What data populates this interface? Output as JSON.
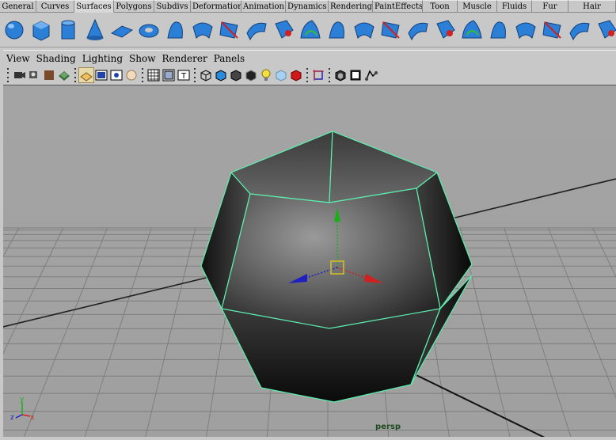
{
  "shelf_tabs": [
    {
      "label": "General",
      "width": 46
    },
    {
      "label": "Curves",
      "width": 48
    },
    {
      "label": "Surfaces",
      "width": 50,
      "active": true
    },
    {
      "label": "Polygons",
      "width": 51
    },
    {
      "label": "Subdivs",
      "width": 46
    },
    {
      "label": "Deformation",
      "width": 64
    },
    {
      "label": "Animation",
      "width": 56
    },
    {
      "label": "Dynamics",
      "width": 54
    },
    {
      "label": "Rendering",
      "width": 56
    },
    {
      "label": "PaintEffects",
      "width": 63
    },
    {
      "label": "Toon",
      "width": 44
    },
    {
      "label": "Muscle",
      "width": 50
    },
    {
      "label": "Fluids",
      "width": 44
    },
    {
      "label": "Fur",
      "width": 46
    },
    {
      "label": "Hair",
      "width": 60
    }
  ],
  "shelf_tools": [
    "nurbs-sphere-icon",
    "nurbs-cube-icon",
    "nurbs-cylinder-icon",
    "nurbs-cone-icon",
    "nurbs-plane-icon",
    "nurbs-torus-icon",
    "revolve-icon",
    "loft-icon",
    "planar-icon",
    "extrude-icon",
    "birail-icon",
    "boundary-icon",
    "square-icon",
    "bevel-icon",
    "bevel-plus-icon",
    "delete-surface-icon",
    "project-curve-icon",
    "trim-tool-icon",
    "attach-surfaces-icon",
    "detach-surfaces-icon",
    "insert-isoparm-icon",
    "extend-surface-icon",
    "offset-surface-icon",
    "sculpt-geometry-icon"
  ],
  "panel_menu": [
    "View",
    "Shading",
    "Lighting",
    "Show",
    "Renderer",
    "Panels"
  ],
  "panel_toolbar": [
    "sep",
    "camera-attributes-icon",
    "bookmark-icon",
    "image-plane-icon",
    "two-d-pan-icon",
    "sep",
    "grid-icon",
    "film-gate-icon",
    "resolution-gate-icon",
    "gate-mask-icon",
    "sep",
    "field-chart-icon",
    "safe-action-icon",
    "safe-title-icon",
    "sep",
    "wireframe-icon",
    "smooth-shade-icon",
    "flat-shade-icon",
    "wireframe-on-shaded-icon",
    "use-default-light-icon",
    "xray-icon",
    "textured-icon",
    "sep",
    "isolate-select-icon",
    "sep",
    "xray-joints-icon",
    "shadows-icon",
    "high-quality-icon"
  ],
  "colors": {
    "wire": "#5cf0b0",
    "axis_x": "#d02020",
    "axis_y": "#18b018",
    "axis_z": "#2020c0",
    "pivot": "#d8c020",
    "shelf_blue": "#2b7fd6"
  },
  "viewport": {
    "camera_label": "persp",
    "axis_labels": {
      "x": "x",
      "y": "y",
      "z": "z"
    }
  }
}
